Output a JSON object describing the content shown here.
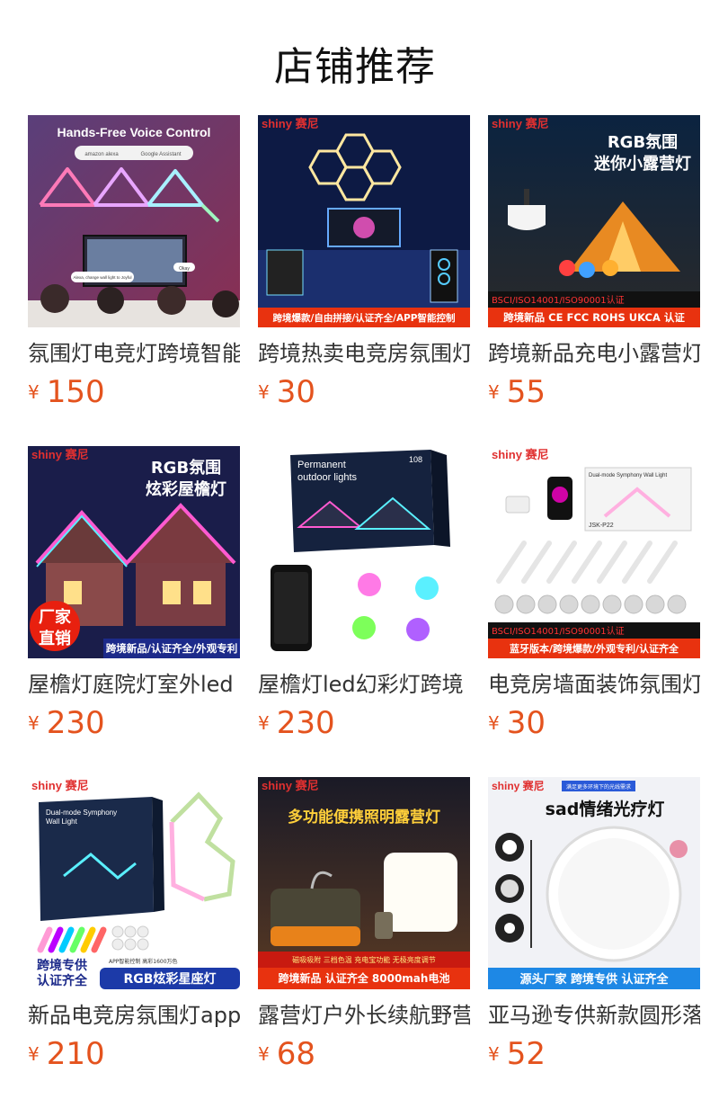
{
  "header": {
    "title": "店铺推荐"
  },
  "currency": "¥",
  "products": [
    {
      "name": "氛围灯电竞灯跨境智能",
      "price": "150",
      "image": {
        "headline": "Hands-Free Voice Control",
        "sub1": "amazon alexa",
        "sub2": "Google Assistant",
        "bubble1": "Alexa, change wall light to Joyful",
        "bubble2": "Okay"
      }
    },
    {
      "name": "跨境热卖电竞房氛围灯",
      "price": "30",
      "image": {
        "brand": "shiny 赛尼",
        "banner": "跨境爆款/自由拼接/认证齐全/APP智能控制"
      }
    },
    {
      "name": "跨境新品充电小露营灯",
      "price": "55",
      "image": {
        "brand": "shiny 赛尼",
        "title1": "RGB氛围",
        "title2": "迷你小露营灯",
        "cert": "BSCI/ISO14001/ISO90001认证",
        "banner": "跨境新品 CE FCC ROHS UKCA 认证"
      }
    },
    {
      "name": "屋檐灯庭院灯室外led",
      "price": "230",
      "image": {
        "brand": "shiny 赛尼",
        "title1": "RGB氛围",
        "title2": "炫彩屋檐灯",
        "badge1": "厂家",
        "badge2": "直销",
        "banner": "跨境新品/认证齐全/外观专利"
      }
    },
    {
      "name": "屋檐灯led幻彩灯跨境",
      "price": "230",
      "image": {
        "box1": "Permanent",
        "box2": "outdoor lights",
        "box3": "108"
      }
    },
    {
      "name": "电竞房墙面装饰氛围灯",
      "price": "30",
      "image": {
        "brand": "shiny 赛尼",
        "box": "Dual-mode Symphony Wall Light",
        "model": "JSK-P22",
        "cert": "BSCI/ISO14001/ISO90001认证",
        "banner": "蓝牙版本/跨境爆款/外观专利/认证齐全"
      }
    },
    {
      "name": "新品电竞房氛围灯app",
      "price": "210",
      "image": {
        "brand": "shiny 赛尼",
        "box1": "Dual-mode Symphony",
        "box2": "Wall Light",
        "sub": "APP智能控制   高彩1600万色",
        "badge1": "跨境专供",
        "badge2": "认证齐全",
        "banner": "RGB炫彩星座灯"
      }
    },
    {
      "name": "露营灯户外长续航野营",
      "price": "68",
      "image": {
        "brand": "shiny 赛尼",
        "title": "多功能便携照明露营灯",
        "sub": "磁吸吸附 三档色温 充电宝功能 无极亮度调节",
        "banner": "跨境新品  认证齐全  8000mah电池"
      }
    },
    {
      "name": "亚马逊专供新款圆形落",
      "price": "52",
      "image": {
        "brand": "shiny 赛尼",
        "tag": "满足更多环境下的光线需求",
        "title": "sad情绪光疗灯",
        "banner": "源头厂家   跨境专供   认证齐全"
      }
    }
  ]
}
